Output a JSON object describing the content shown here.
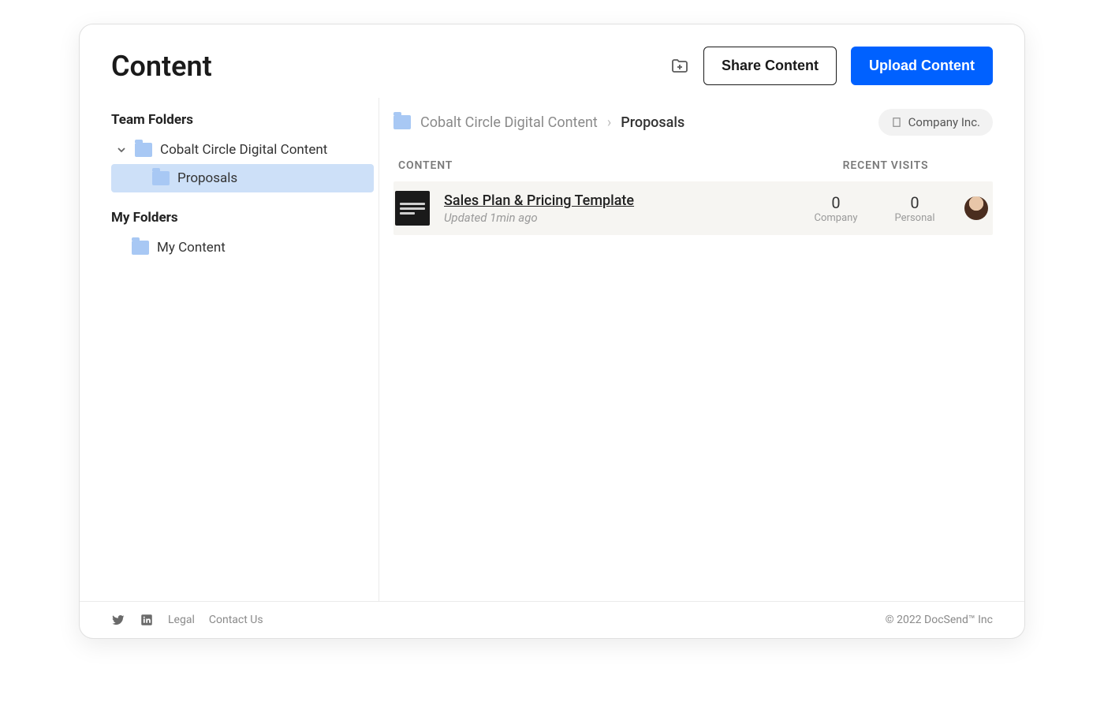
{
  "header": {
    "title": "Content",
    "share_label": "Share Content",
    "upload_label": "Upload Content"
  },
  "sidebar": {
    "team_heading": "Team Folders",
    "my_heading": "My Folders",
    "team_root": "Cobalt Circle Digital Content",
    "team_child": "Proposals",
    "my_root": "My Content"
  },
  "breadcrumb": {
    "parent": "Cobalt Circle Digital Content",
    "current": "Proposals"
  },
  "company_pill": "Company Inc.",
  "columns": {
    "content": "CONTENT",
    "recent": "RECENT VISITS"
  },
  "doc": {
    "title": "Sales Plan & Pricing Template",
    "updated": "Updated 1min ago",
    "company_count": "0",
    "company_label": "Company",
    "personal_count": "0",
    "personal_label": "Personal"
  },
  "footer": {
    "legal": "Legal",
    "contact": "Contact Us",
    "copyright": "© 2022 DocSend™ Inc"
  }
}
